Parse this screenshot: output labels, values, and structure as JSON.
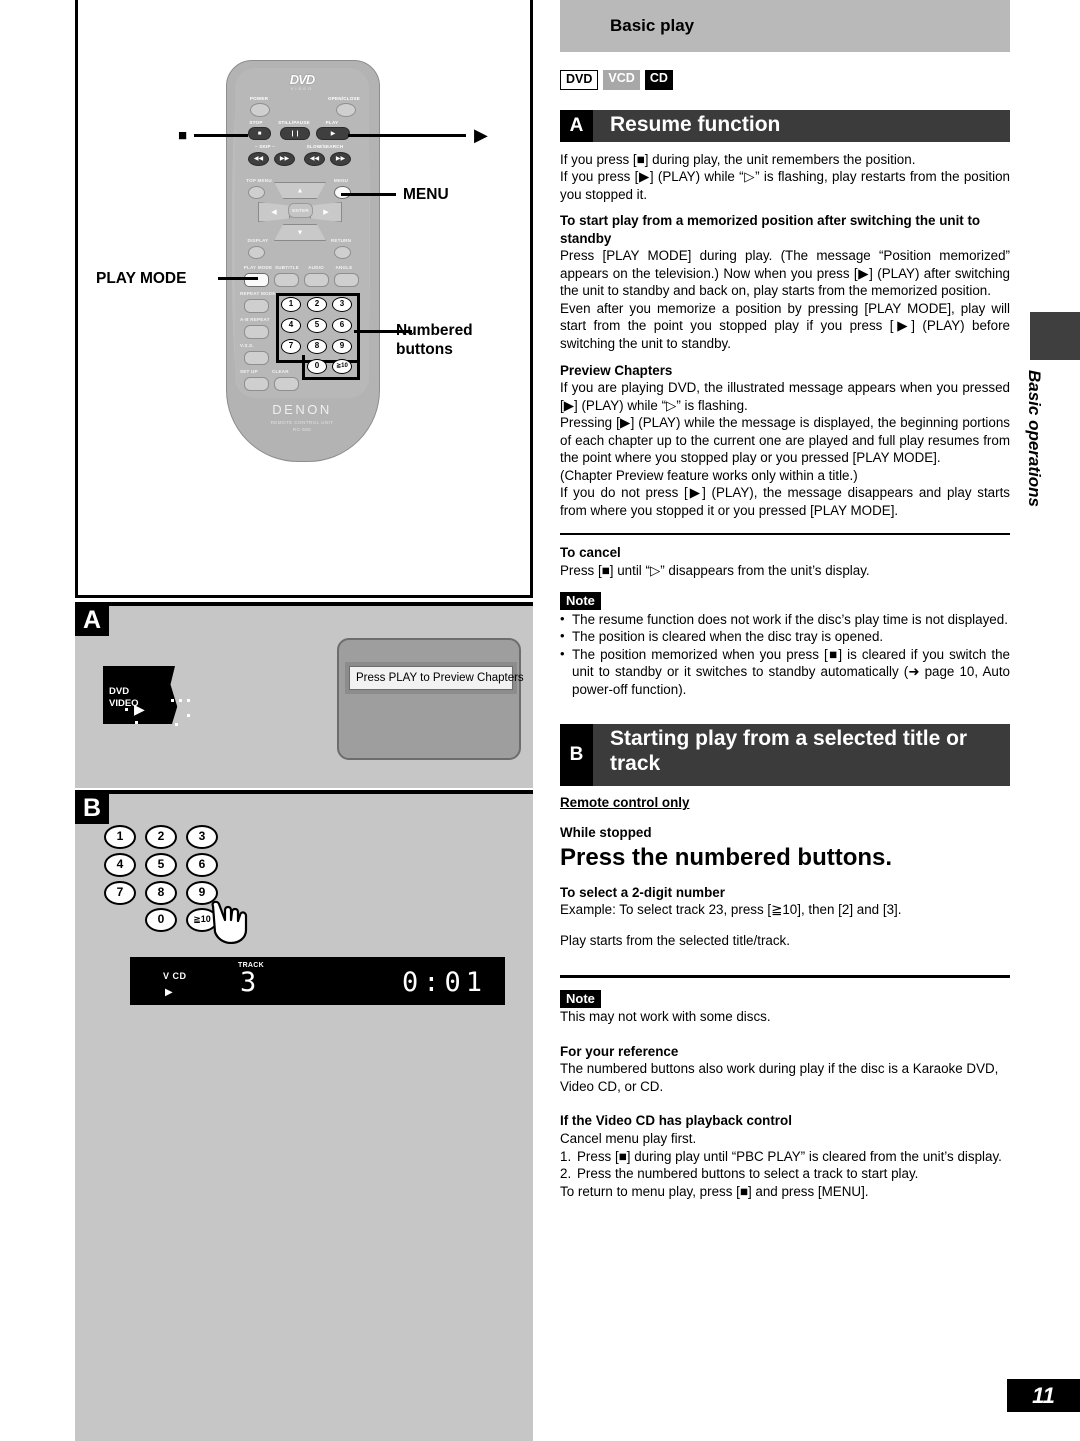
{
  "page": {
    "number": "11",
    "side_tab": "Basic operations"
  },
  "right": {
    "gray_banner": "Basic play",
    "badges": [
      {
        "label": "DVD",
        "style": "outline"
      },
      {
        "label": "VCD",
        "style": "gray"
      },
      {
        "label": "CD",
        "style": "black"
      }
    ],
    "section_a": {
      "tag": "A",
      "title": "Resume function",
      "p1": "If you press [■] during play, the unit remembers the position.",
      "p2": "If you press [▶] (PLAY) while “▷” is flashing, play restarts from the position you stopped it.",
      "h1": "To start play from a memorized position after switching the unit to standby",
      "p3": "Press [PLAY MODE] during play. (The message “Position memorized” appears on the television.) Now when you press [▶] (PLAY) after switching the unit to standby and back on, play starts from the memorized position.",
      "p4": "Even after you memorize a position by pressing [PLAY MODE], play will start from the point you stopped play if you press [▶] (PLAY) before switching the unit to standby.",
      "h2": "Preview Chapters",
      "p5": "If you are playing DVD, the illustrated message appears when you pressed [▶] (PLAY) while “▷” is flashing.",
      "p6": "Pressing [▶] (PLAY) while the message is displayed, the beginning portions of each chapter up to the current one are played and full play resumes from the point where you stopped play or you pressed [PLAY MODE].",
      "p7": "(Chapter Preview feature works only within a title.)",
      "p8": "If you do not press [▶] (PLAY), the message disappears and play starts from where you stopped it or you pressed [PLAY MODE].",
      "h3": "To cancel",
      "p9": "Press [■] until “▷” disappears from the unit’s display.",
      "note_tag": "Note",
      "notes": [
        "The resume function does not work if the disc’s play time is not displayed.",
        "The position is cleared when the disc tray is opened.",
        "The position memorized when you press [■] is cleared if you switch the unit to standby or it switches to standby automatically (➜ page 10, Auto power-off function)."
      ]
    },
    "section_b": {
      "tag": "B",
      "title": "Starting play from a selected title or track",
      "remote_only": "Remote control only",
      "while_stopped": "While stopped",
      "instruction": "Press the numbered buttons.",
      "h1": "To select a 2-digit number",
      "p1": "Example:  To select track 23, press [≧10], then [2] and [3].",
      "p2": "Play starts from the selected title/track.",
      "note_tag": "Note",
      "note": "This may not work with some discs.",
      "h2": "For your reference",
      "p3": "The numbered buttons also work during play if the disc is a Karaoke DVD, Video CD, or CD.",
      "h3": "If the Video CD has playback control",
      "p4": "Cancel menu play first.",
      "steps": [
        "Press [■] during play until “PBC PLAY” is cleared from the unit’s display.",
        "Press the numbered buttons to select a track to start play."
      ],
      "p5": "To return to menu play, press [■]  and press [MENU]."
    }
  },
  "left": {
    "remote": {
      "logo_main": "DVD",
      "logo_sub": "VIDEO",
      "brand": "DENON",
      "unit_line1": "REMOTE CONTROL UNIT",
      "unit_line2": "RC-550",
      "buttons": {
        "power": "POWER",
        "open_close": "OPEN/CLOSE",
        "stop": "STOP",
        "still_pause": "STILL/PAUSE",
        "play": "PLAY",
        "skip": "– SKIP –",
        "slow_search": "SLOW/SEARCH",
        "top_menu": "TOP MENU",
        "menu": "MENU",
        "enter": "ENTER",
        "display": "DISPLAY",
        "return": "RETURN",
        "play_mode": "PLAY MODE",
        "subtitle": "SUBTITLE",
        "audio": "AUDIO",
        "angle": "ANGLE",
        "repeat_mode": "REPEAT MODE",
        "ab_repeat": "A-B REPEAT",
        "vss": "V.S.S.",
        "set_up": "SET UP",
        "clear": "CLEAR"
      },
      "keypad": [
        "1",
        "2",
        "3",
        "4",
        "5",
        "6",
        "7",
        "8",
        "9",
        "0",
        "≧10"
      ]
    },
    "callouts": {
      "stop_glyph": "■",
      "play_glyph": "▶",
      "menu": "MENU",
      "play_mode": "PLAY MODE",
      "numbered_line1": "Numbered",
      "numbered_line2": "buttons"
    },
    "figure_a": {
      "tag": "A",
      "disc_line1": "DVD",
      "disc_line2": "VIDEO",
      "tv_message": "Press PLAY to Preview Chapters"
    },
    "figure_b": {
      "tag": "B",
      "keypad": [
        "1",
        "2",
        "3",
        "4",
        "5",
        "6",
        "7",
        "8",
        "9",
        "0",
        "≧10"
      ],
      "display": {
        "disc_type": "V CD",
        "play_glyph": "▶",
        "track_label": "TRACK",
        "track_number": "3",
        "time": "0:01"
      }
    }
  }
}
